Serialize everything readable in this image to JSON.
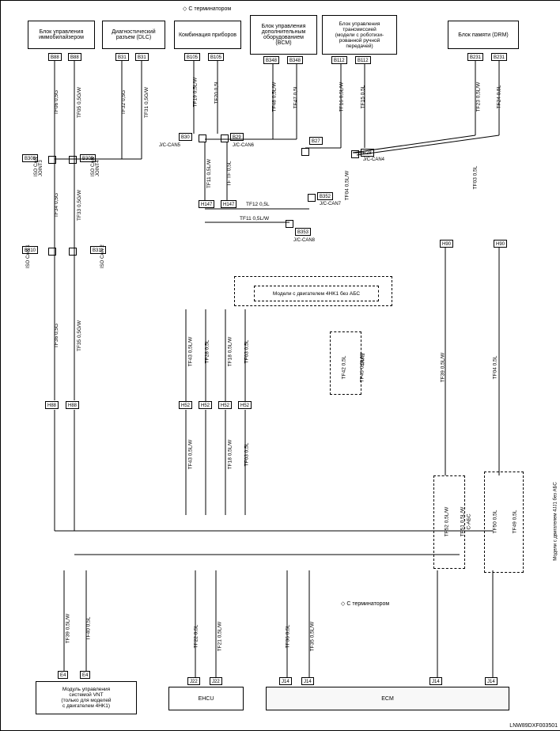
{
  "header_note_top": "С терминатором",
  "header_note_bottom": "С терминатором",
  "footer_code": "LNW89DXF003501",
  "boxes": {
    "immob": "Блок управления\nиммобилайзером",
    "diag": "Диагностический\nразъем (DLC)",
    "cluster": "Комбинация приборов",
    "bcm": "Блок управления\nдополнительным\nоборудованием\n(BCM)",
    "trans": "Блок управления\nтрансмиссией\n(модели с роботизи-\nрованной ручной\nпередачей)",
    "drm": "Блок памяти (DRM)",
    "vnt": "Модуль управления\nсистемой VNT\n(только для моделей\nс двигателем 4HK1)",
    "ehcu": "EHCU",
    "ecm": "ECM",
    "abs_note": "Модели с двигателем 4HK1 без АБС",
    "abs_note2": "Модели с двигателем 4JJ1 без АБС",
    "cabs": "С-АБС",
    "4hk1": "4HK1"
  },
  "joints": {
    "j1": "ISO CAN\nJOINT3",
    "j2": "ISO CAN\nJOINT4",
    "j3": "ISO CAN 1",
    "j4": "ISO CAN 2",
    "jcan5": "J/C-CAN5",
    "jcan6": "J/C-CAN6",
    "jcan7": "J/C-CAN7",
    "jcan8": "J/C-CAN8",
    "jcan4": "J/C-CAN4"
  },
  "pins": {
    "b88": "B88",
    "b31": "B31",
    "b105": "B105",
    "b348": "B348",
    "b112": "B112",
    "b231": "B231",
    "b308": "B308",
    "b309": "B309",
    "b310": "B310",
    "b311": "B311",
    "b30": "B30",
    "b29": "B29",
    "b27": "B27",
    "b28": "B28",
    "b352": "B352",
    "b353": "B353",
    "h147": "H147",
    "h88": "H88",
    "h52": "H52",
    "h90": "H90",
    "e4": "E4",
    "j22": "J22",
    "j14": "J14"
  },
  "wires": {
    "tf06": "TF06 0,5G",
    "tf05": "TF05 0,5G/W",
    "tf32": "TF32 0,5G",
    "tf31": "TF31 0,5G/W",
    "tf19": "TF19 0,5L/W",
    "tf20": "TF20 0,5L",
    "tf48": "TF48 0,5L/W",
    "tf47": "TF47 0,5L",
    "tf16": "TF16 0,5L/W",
    "tf15": "TF15 0,5L",
    "tf23": "TF23 0,5L/W",
    "tf24": "TF24 0,5L",
    "tf34": "TF34 0,5G",
    "tf33": "TF33 0,5G/W",
    "tf11": "TF11 0,5L/W",
    "tf11b": "TF TF 0,5L",
    "tf12": "TF12 0,5L",
    "tf11w": "TF11 0,5L/W",
    "tf04": "TF04 0,5L/W",
    "tf03": "TF03 0,5L",
    "tf36": "TF36 0,5G",
    "tf35": "TF35 0,5G/W",
    "tf43": "TF43 0,5L/W",
    "tf28": "TF28 0,5L",
    "tf18": "TF18 0,5L/W",
    "tf03b": "TF03 0,5L",
    "tf43b": "TF43 0,5L/W",
    "tf18b": "TF18 0,5L/W",
    "tf42": "TF42 0,5L",
    "tf43c": "TF43 0,5L/W",
    "tf39": "TF39 0,5L/W",
    "tf04b": "TF04 0,5L",
    "tf52": "TF52 0,5L/W",
    "tf51": "TF51 0,5L/W",
    "tf50": "TF50 0,5L",
    "tf49": "TF49 0,5L",
    "tf39b": "TF39 0,5L/W",
    "tf40": "TF40 0,5L",
    "tf22": "TF22 0,5L",
    "tf21": "TF21 0,5L/W",
    "tf36b": "TF36 0,5L",
    "tf35b": "TF35 0,5L/W"
  }
}
